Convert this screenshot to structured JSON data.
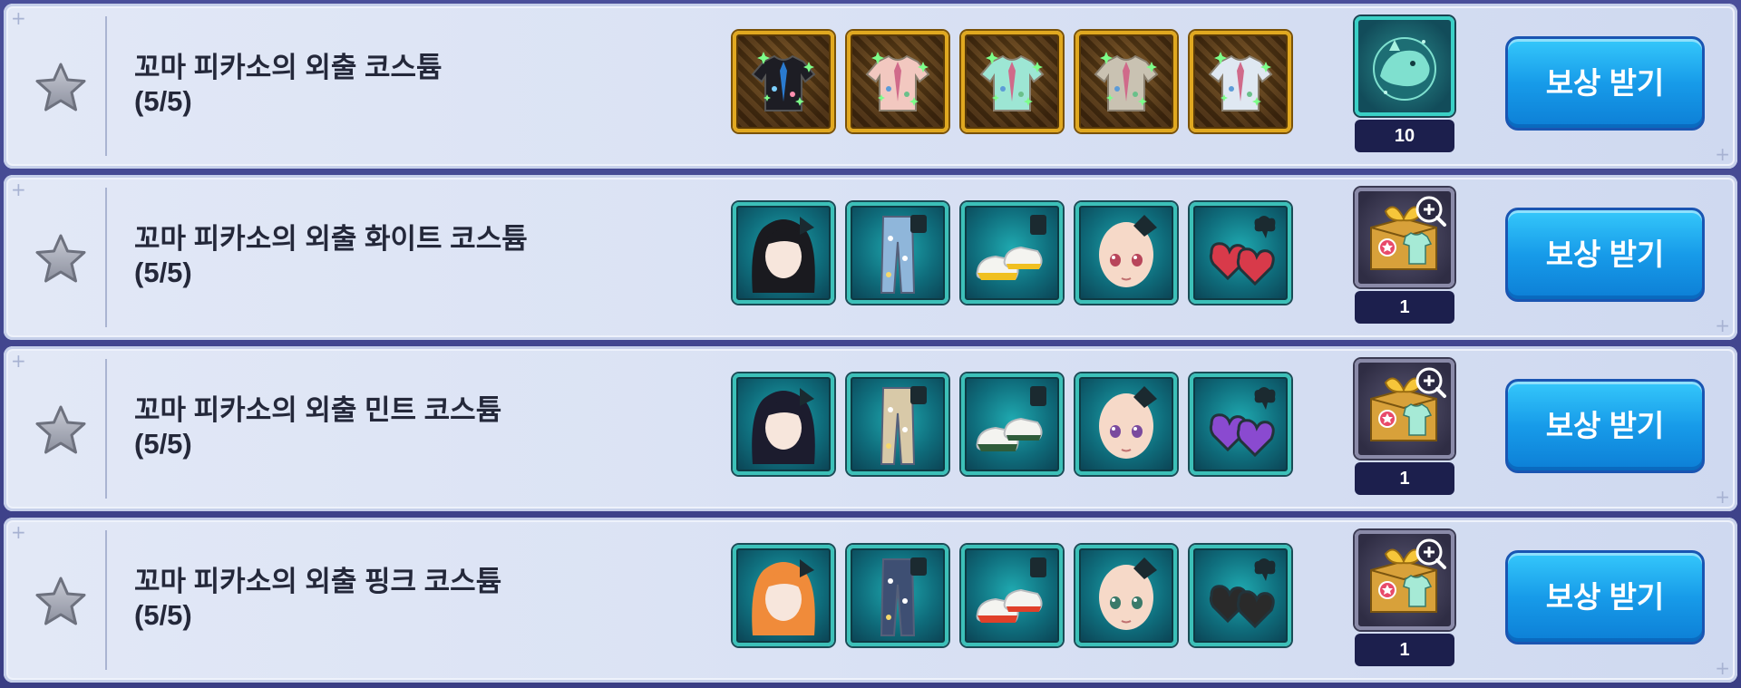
{
  "rows": [
    {
      "title": "꼬마 피카소의 외출 코스튬",
      "progress": "(5/5)",
      "item_style": "gold",
      "items": [
        "shirt-black-icon",
        "shirt-pink-icon",
        "shirt-mint-icon",
        "shirt-navy-icon",
        "shirt-white-icon"
      ],
      "reward_icon": "mount-egg-icon",
      "reward_count": "10",
      "claim_label": "보상 받기"
    },
    {
      "title": "꼬마 피카소의 외출 화이트 코스튬",
      "progress": "(5/5)",
      "item_style": "teal",
      "items": [
        "hair-icon",
        "pants-icon",
        "shoes-icon",
        "face-icon",
        "earrings-icon"
      ],
      "reward_icon": "costume-box-icon",
      "reward_count": "1",
      "claim_label": "보상 받기"
    },
    {
      "title": "꼬마 피카소의 외출 민트 코스튬",
      "progress": "(5/5)",
      "item_style": "teal",
      "items": [
        "hair-icon",
        "pants-icon",
        "shoes-icon",
        "face-icon",
        "earrings-icon"
      ],
      "reward_icon": "costume-box-icon",
      "reward_count": "1",
      "claim_label": "보상 받기"
    },
    {
      "title": "꼬마 피카소의 외출 핑크 코스튬",
      "progress": "(5/5)",
      "item_style": "teal",
      "items": [
        "hair-icon",
        "pants-icon",
        "shoes-icon",
        "face-icon",
        "earrings-icon"
      ],
      "reward_icon": "costume-box-icon",
      "reward_count": "1",
      "claim_label": "보상 받기"
    }
  ],
  "colors": {
    "claim_button": "#179be9",
    "row_background": "#dae2f4",
    "gold_frame": "#e0a820",
    "teal_frame": "#3cc0b8",
    "count_badge": "#1c1f4d"
  },
  "variants": {
    "shirt_colors": [
      "#1d1d24",
      "#f2c8c0",
      "#9de6d4",
      "#c9c2b2",
      "#dfe8f2"
    ],
    "hair_colors": [
      "#1a1a1f",
      "#1c1c2e",
      "#f08b3a"
    ],
    "pants_colors": [
      "#8fb6da",
      "#d8c9a8",
      "#3e4f73"
    ],
    "shoe_colors": [
      "#f0c020",
      "#2f5c3a",
      "#e0402a"
    ],
    "eye_colors": [
      "#b8455a",
      "#7a4a9e",
      "#3a7a6a"
    ],
    "earring_colors": [
      "#d83a4a",
      "#8a4ad0",
      "#2a2a2a"
    ]
  }
}
